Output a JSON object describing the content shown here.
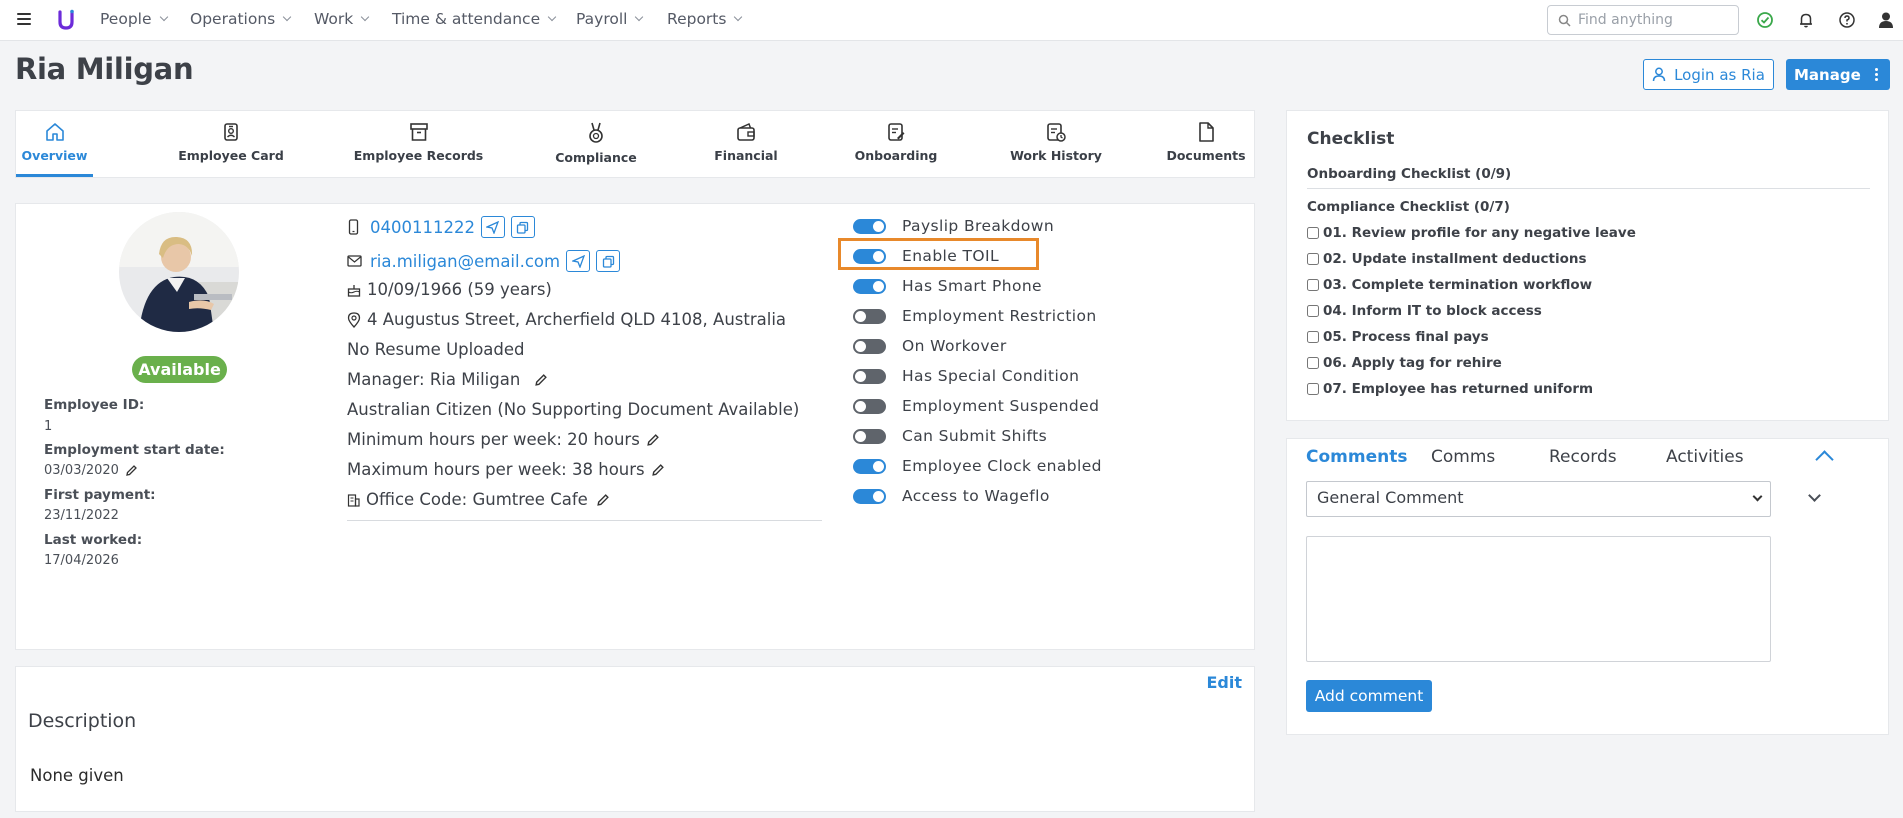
{
  "nav": {
    "menu": [
      "People",
      "Operations",
      "Work",
      "Time & attendance",
      "Payroll",
      "Reports"
    ],
    "search_placeholder": "Find anything"
  },
  "page_title": "Ria Miligan",
  "actions": {
    "login_label": "Login as Ria",
    "manage_label": "Manage"
  },
  "tabs": [
    {
      "label": "Overview",
      "icon": "home-icon",
      "active": true
    },
    {
      "label": "Employee Card",
      "icon": "id-card-icon"
    },
    {
      "label": "Employee Records",
      "icon": "archive-icon"
    },
    {
      "label": "Compliance",
      "icon": "medal-icon"
    },
    {
      "label": "Financial",
      "icon": "wallet-icon"
    },
    {
      "label": "Onboarding",
      "icon": "edit-doc-icon"
    },
    {
      "label": "Work History",
      "icon": "history-doc-icon"
    },
    {
      "label": "Documents",
      "icon": "file-icon"
    }
  ],
  "profile": {
    "status": "Available",
    "employee_id_label": "Employee ID:",
    "employee_id": "1",
    "start_label": "Employment start date:",
    "start_date": "03/03/2020",
    "first_payment_label": "First payment:",
    "first_payment": "23/11/2022",
    "last_worked_label": "Last worked:",
    "last_worked": "17/04/2026"
  },
  "info": {
    "phone": "0400111222",
    "email": "ria.miligan@email.com",
    "dob": "10/09/1966 (59 years)",
    "address": "4 Augustus Street, Archerfield QLD 4108, Australia",
    "resume": "No Resume Uploaded",
    "manager": "Manager: Ria Miligan",
    "citizenship": "Australian Citizen (No Supporting Document Available)",
    "min_hours": "Minimum hours per week: 20 hours",
    "max_hours": "Maximum hours per week: 38 hours",
    "office": "Office Code: Gumtree Cafe"
  },
  "toggles": [
    {
      "label": "Payslip Breakdown",
      "on": true
    },
    {
      "label": "Enable TOIL",
      "on": true
    },
    {
      "label": "Has Smart Phone",
      "on": true
    },
    {
      "label": "Employment Restriction",
      "on": false
    },
    {
      "label": "On Workover",
      "on": false
    },
    {
      "label": "Has Special Condition",
      "on": false
    },
    {
      "label": "Employment Suspended",
      "on": false
    },
    {
      "label": "Can Submit Shifts",
      "on": false
    },
    {
      "label": "Employee Clock enabled",
      "on": true
    },
    {
      "label": "Access to Wageflo",
      "on": true
    }
  ],
  "description": {
    "edit_label": "Edit",
    "title": "Description",
    "body": "None given"
  },
  "checklist": {
    "title": "Checklist",
    "onboarding": "Onboarding Checklist (0/9)",
    "compliance": "Compliance Checklist (0/7)",
    "items": [
      "01. Review profile for any negative leave",
      "02. Update installment deductions",
      "03. Complete termination workflow",
      "04. Inform IT to block access",
      "05. Process final pays",
      "06. Apply tag for rehire",
      "07. Employee has returned uniform"
    ]
  },
  "comments": {
    "tabs": [
      "Comments",
      "Comms",
      "Records",
      "Activities"
    ],
    "select_value": "General Comment",
    "add_label": "Add comment"
  },
  "colors": {
    "accent": "#2b88d8",
    "available": "#6ab04c",
    "highlight": "#e8892b"
  }
}
